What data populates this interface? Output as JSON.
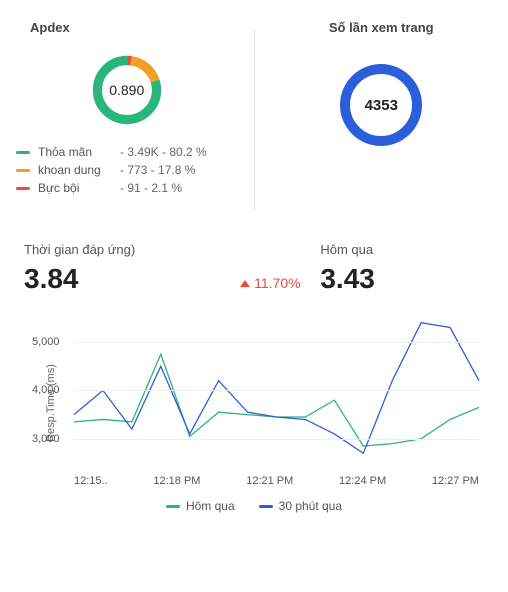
{
  "colors": {
    "green": "#2ab57d",
    "orange": "#f0a024",
    "red": "#e74c3c",
    "blue": "#2b5fd9"
  },
  "apdex": {
    "title": "Apdex",
    "value": "0.890",
    "legend": [
      {
        "name": "Thỏa mãn",
        "stats": "- 3.49K - 80.2 %",
        "color": "#2ab57d"
      },
      {
        "name": "khoan dung",
        "stats": "- 773 - 17.8 %",
        "color": "#f0a024"
      },
      {
        "name": "Bực bội",
        "stats": "- 91 - 2.1 %",
        "color": "#e74c3c"
      }
    ]
  },
  "pageviews": {
    "title": "Số lần xem trang",
    "value": "4353"
  },
  "response_time": {
    "title_left": "Thời gian đáp ứng)",
    "value_left": "3.84",
    "delta": "11.70%",
    "title_right": "Hôm qua",
    "value_right": "3.43",
    "y_label": "Resp.Time (ms)"
  },
  "line_legend": [
    {
      "label": "Hôm qua",
      "color": "#2ab57d"
    },
    {
      "label": "30 phút qua",
      "color": "#2b5fd9"
    }
  ],
  "chart_data": {
    "type": "line",
    "xlabel": "",
    "ylabel": "Resp.Time (ms)",
    "ylim": [
      2500,
      5600
    ],
    "y_ticks": [
      "3,000",
      "4,000",
      "5,000"
    ],
    "categories": [
      "12:15..",
      "12:18 PM",
      "12:21 PM",
      "12:24 PM",
      "12:27 PM"
    ],
    "x": [
      0,
      1,
      2,
      3,
      4,
      5,
      6,
      7,
      8,
      9,
      10,
      11,
      12,
      13,
      14
    ],
    "series": [
      {
        "name": "Hôm qua",
        "color": "#2ab57d",
        "values": [
          3350,
          3400,
          3350,
          4750,
          3050,
          3550,
          3500,
          3450,
          3450,
          3800,
          2850,
          2900,
          3000,
          3400,
          3650
        ]
      },
      {
        "name": "30 phút qua",
        "color": "#2b5fd9",
        "values": [
          3500,
          4000,
          3200,
          4500,
          3100,
          4200,
          3550,
          3450,
          3400,
          3100,
          2700,
          4200,
          5400,
          5300,
          4200
        ]
      }
    ]
  }
}
